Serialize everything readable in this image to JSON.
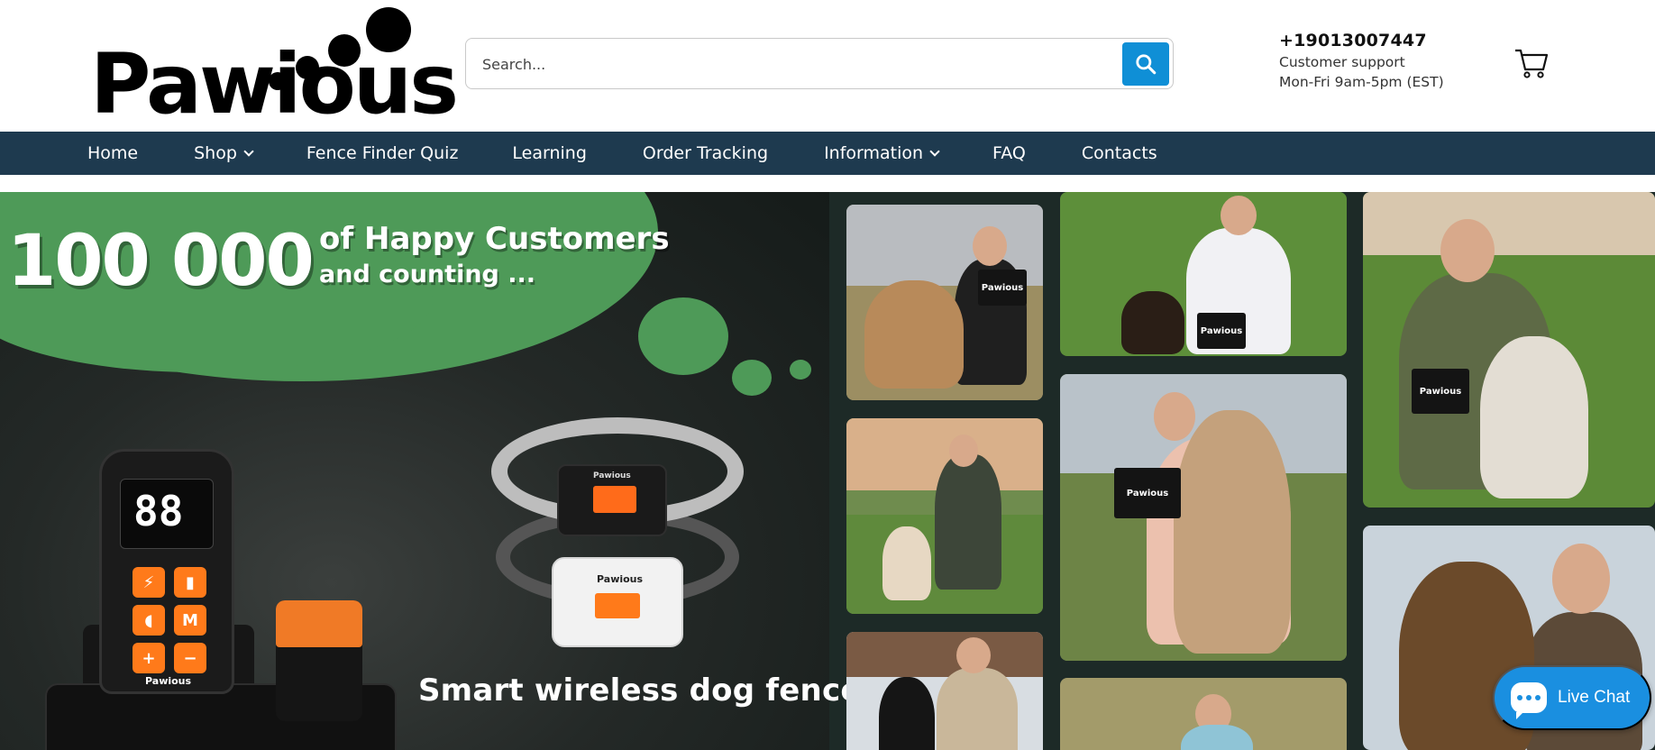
{
  "brand": {
    "logo_text": "Pawious",
    "accent_color": "#0f8fd6",
    "nav_bg": "#1e3a4f",
    "hero_green": "#4e9a58"
  },
  "search": {
    "placeholder": "Search...",
    "button_icon": "search-icon"
  },
  "contact": {
    "phone": "+19013007447",
    "support_label": "Customer support",
    "hours": "Mon-Fri 9am-5pm (EST)"
  },
  "cart": {
    "icon": "cart-icon"
  },
  "nav": {
    "items": [
      {
        "label": "Home",
        "has_dropdown": false
      },
      {
        "label": "Shop",
        "has_dropdown": true
      },
      {
        "label": "Fence Finder Quiz",
        "has_dropdown": false
      },
      {
        "label": "Learning",
        "has_dropdown": false
      },
      {
        "label": "Order Tracking",
        "has_dropdown": false
      },
      {
        "label": "Information",
        "has_dropdown": true
      },
      {
        "label": "FAQ",
        "has_dropdown": false
      },
      {
        "label": "Contacts",
        "has_dropdown": false
      }
    ]
  },
  "hero": {
    "count": "100 000",
    "headline_line1": "of Happy Customers",
    "headline_line2": "and counting ...",
    "tagline": "Smart wireless dog fences",
    "remote_display": "88",
    "remote_buttons": [
      "⚡",
      "▮",
      "◖",
      "M",
      "+",
      "−"
    ],
    "product_brand": "Pawious",
    "photo_box_label": "Pawious"
  },
  "chat": {
    "label": "Live Chat",
    "icon": "chat-bubble-icon"
  }
}
